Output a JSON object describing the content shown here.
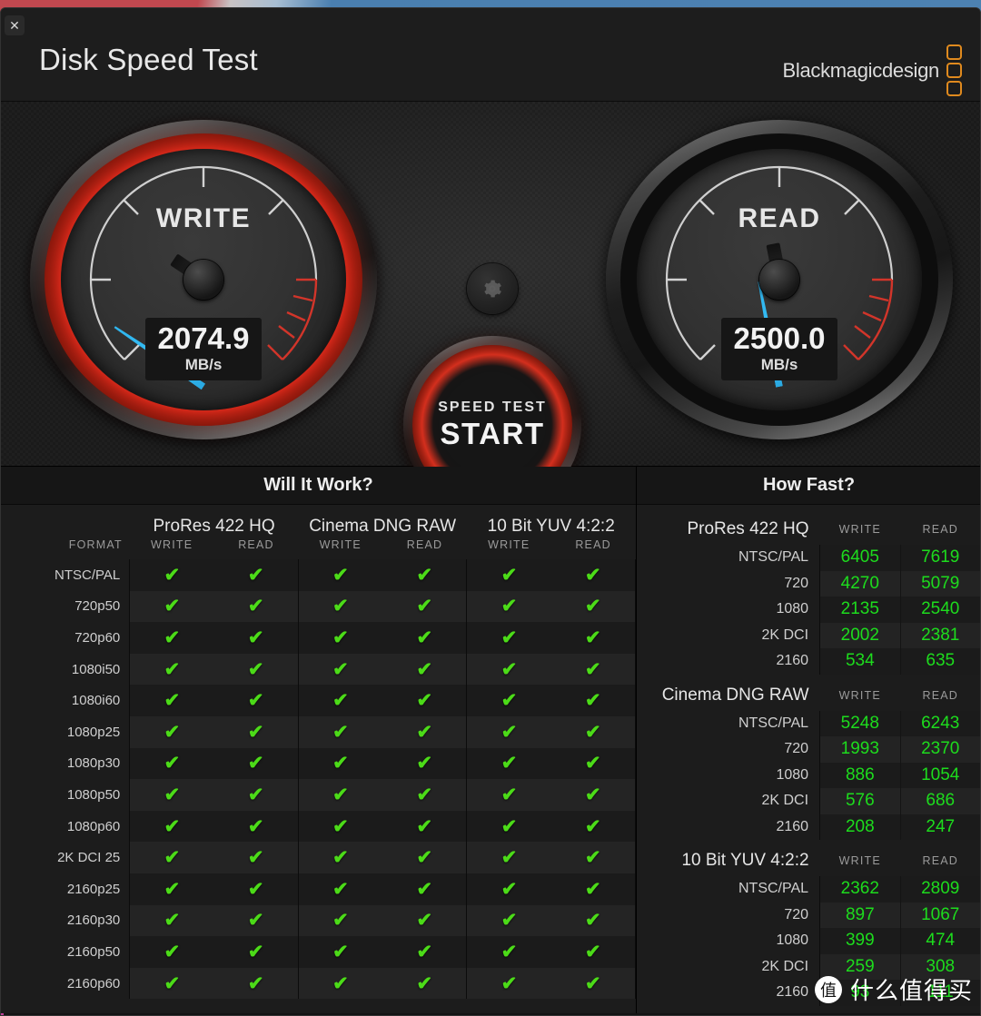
{
  "window": {
    "title": "Disk Speed Test",
    "close_label": "✕",
    "brand_text": "Blackmagicdesign",
    "brand_accent": "#e08a1e"
  },
  "gauges": {
    "write": {
      "label": "WRITE",
      "value": "2074.9",
      "unit": "MB/s",
      "needle_deg": -56,
      "glow": true
    },
    "read": {
      "label": "READ",
      "value": "2500.0",
      "unit": "MB/s",
      "needle_deg": -11,
      "glow": false
    }
  },
  "start_button": {
    "sub_label": "SPEED TEST",
    "main_label": "START"
  },
  "settings_button": {
    "icon": "gear-icon"
  },
  "will_it_work": {
    "title": "Will It Work?",
    "format_header": "FORMAT",
    "groups": [
      "ProRes 422 HQ",
      "Cinema DNG RAW",
      "10 Bit YUV 4:2:2"
    ],
    "sub_headers": [
      "WRITE",
      "READ"
    ],
    "rows": [
      "NTSC/PAL",
      "720p50",
      "720p60",
      "1080i50",
      "1080i60",
      "1080p25",
      "1080p30",
      "1080p50",
      "1080p60",
      "2K DCI 25",
      "2160p25",
      "2160p30",
      "2160p50",
      "2160p60"
    ],
    "check_glyph": "✔",
    "check_color": "#4cdb18",
    "results": [
      [
        true,
        true,
        true,
        true,
        true,
        true
      ],
      [
        true,
        true,
        true,
        true,
        true,
        true
      ],
      [
        true,
        true,
        true,
        true,
        true,
        true
      ],
      [
        true,
        true,
        true,
        true,
        true,
        true
      ],
      [
        true,
        true,
        true,
        true,
        true,
        true
      ],
      [
        true,
        true,
        true,
        true,
        true,
        true
      ],
      [
        true,
        true,
        true,
        true,
        true,
        true
      ],
      [
        true,
        true,
        true,
        true,
        true,
        true
      ],
      [
        true,
        true,
        true,
        true,
        true,
        true
      ],
      [
        true,
        true,
        true,
        true,
        true,
        true
      ],
      [
        true,
        true,
        true,
        true,
        true,
        true
      ],
      [
        true,
        true,
        true,
        true,
        true,
        true
      ],
      [
        true,
        true,
        true,
        true,
        true,
        true
      ],
      [
        true,
        true,
        true,
        true,
        true,
        true
      ]
    ]
  },
  "how_fast": {
    "title": "How Fast?",
    "sub_headers": [
      "WRITE",
      "READ"
    ],
    "value_color": "#1ddc1d",
    "sections": [
      {
        "name": "ProRes 422 HQ",
        "rows": [
          {
            "label": "NTSC/PAL",
            "write": "6405",
            "read": "7619"
          },
          {
            "label": "720",
            "write": "4270",
            "read": "5079"
          },
          {
            "label": "1080",
            "write": "2135",
            "read": "2540"
          },
          {
            "label": "2K DCI",
            "write": "2002",
            "read": "2381"
          },
          {
            "label": "2160",
            "write": "534",
            "read": "635"
          }
        ]
      },
      {
        "name": "Cinema DNG RAW",
        "rows": [
          {
            "label": "NTSC/PAL",
            "write": "5248",
            "read": "6243"
          },
          {
            "label": "720",
            "write": "1993",
            "read": "2370"
          },
          {
            "label": "1080",
            "write": "886",
            "read": "1054"
          },
          {
            "label": "2K DCI",
            "write": "576",
            "read": "686"
          },
          {
            "label": "2160",
            "write": "208",
            "read": "247"
          }
        ]
      },
      {
        "name": "10 Bit YUV 4:2:2",
        "rows": [
          {
            "label": "NTSC/PAL",
            "write": "2362",
            "read": "2809"
          },
          {
            "label": "720",
            "write": "897",
            "read": "1067"
          },
          {
            "label": "1080",
            "write": "399",
            "read": "474"
          },
          {
            "label": "2K DCI",
            "write": "259",
            "read": "308"
          },
          {
            "label": "2160",
            "write": "93",
            "read": "111"
          }
        ]
      }
    ]
  },
  "watermark": {
    "badge": "值",
    "text": "什么值得买"
  }
}
